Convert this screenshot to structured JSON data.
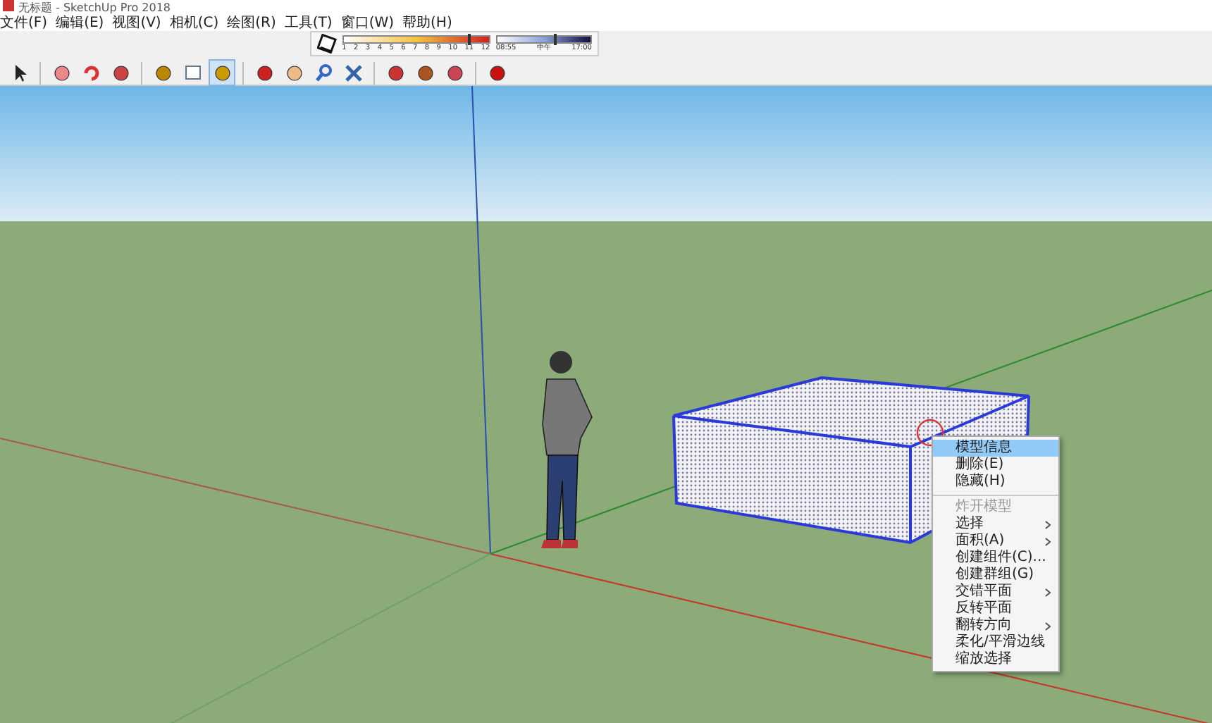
{
  "window": {
    "title": "无标题 - SketchUp Pro 2018"
  },
  "menu_bar": [
    "文件(F)",
    "编辑(E)",
    "视图(V)",
    "相机(C)",
    "绘图(R)",
    "工具(T)",
    "窗口(W)",
    "帮助(H)"
  ],
  "shadow_toolbar": {
    "months": [
      "1",
      "2",
      "3",
      "4",
      "5",
      "6",
      "7",
      "8",
      "9",
      "10",
      "11",
      "12"
    ],
    "date_slider": {
      "level": 0.86
    },
    "time_labels": [
      "08:55",
      "中午",
      "17:00"
    ],
    "time_slider": {
      "level": 0.6
    }
  },
  "toolbar": {
    "tools": [
      {
        "kind": "select",
        "selected": false
      },
      {
        "kind": "eraser",
        "selected": false
      },
      {
        "kind": "rotate",
        "selected": false
      },
      {
        "kind": "scale",
        "selected": false
      },
      {
        "kind": "tape",
        "selected": false
      },
      {
        "kind": "text",
        "selected": false
      },
      {
        "kind": "paint",
        "selected": true
      },
      {
        "kind": "orbit",
        "selected": false
      },
      {
        "kind": "pan",
        "selected": false
      },
      {
        "kind": "zoom",
        "selected": false
      },
      {
        "kind": "extents",
        "selected": false
      },
      {
        "kind": "warehouse",
        "selected": false
      },
      {
        "kind": "components",
        "selected": false
      },
      {
        "kind": "share",
        "selected": false
      },
      {
        "kind": "ruby",
        "selected": false
      }
    ]
  },
  "context_menu": {
    "items": [
      {
        "label": "模型信息",
        "selected": true,
        "disabled": false,
        "submenu": false,
        "separator_before": false
      },
      {
        "label": "删除(E)",
        "selected": false,
        "disabled": false,
        "submenu": false,
        "separator_before": false
      },
      {
        "label": "隐藏(H)",
        "selected": false,
        "disabled": false,
        "submenu": false,
        "separator_before": false
      },
      {
        "label": "炸开模型",
        "selected": false,
        "disabled": true,
        "submenu": false,
        "separator_before": true
      },
      {
        "label": "选择",
        "selected": false,
        "disabled": false,
        "submenu": true,
        "separator_before": false
      },
      {
        "label": "面积(A)",
        "selected": false,
        "disabled": false,
        "submenu": true,
        "separator_before": false
      },
      {
        "label": "创建组件(C)...",
        "selected": false,
        "disabled": false,
        "submenu": false,
        "separator_before": false
      },
      {
        "label": "创建群组(G)",
        "selected": false,
        "disabled": false,
        "submenu": false,
        "separator_before": false
      },
      {
        "label": "交错平面",
        "selected": false,
        "disabled": false,
        "submenu": true,
        "separator_before": false
      },
      {
        "label": "反转平面",
        "selected": false,
        "disabled": false,
        "submenu": false,
        "separator_before": false
      },
      {
        "label": "翻转方向",
        "selected": false,
        "disabled": false,
        "submenu": true,
        "separator_before": false
      },
      {
        "label": "柔化/平滑边线",
        "selected": false,
        "disabled": false,
        "submenu": false,
        "separator_before": false
      },
      {
        "label": "缩放选择",
        "selected": false,
        "disabled": false,
        "submenu": false,
        "separator_before": false
      }
    ]
  }
}
